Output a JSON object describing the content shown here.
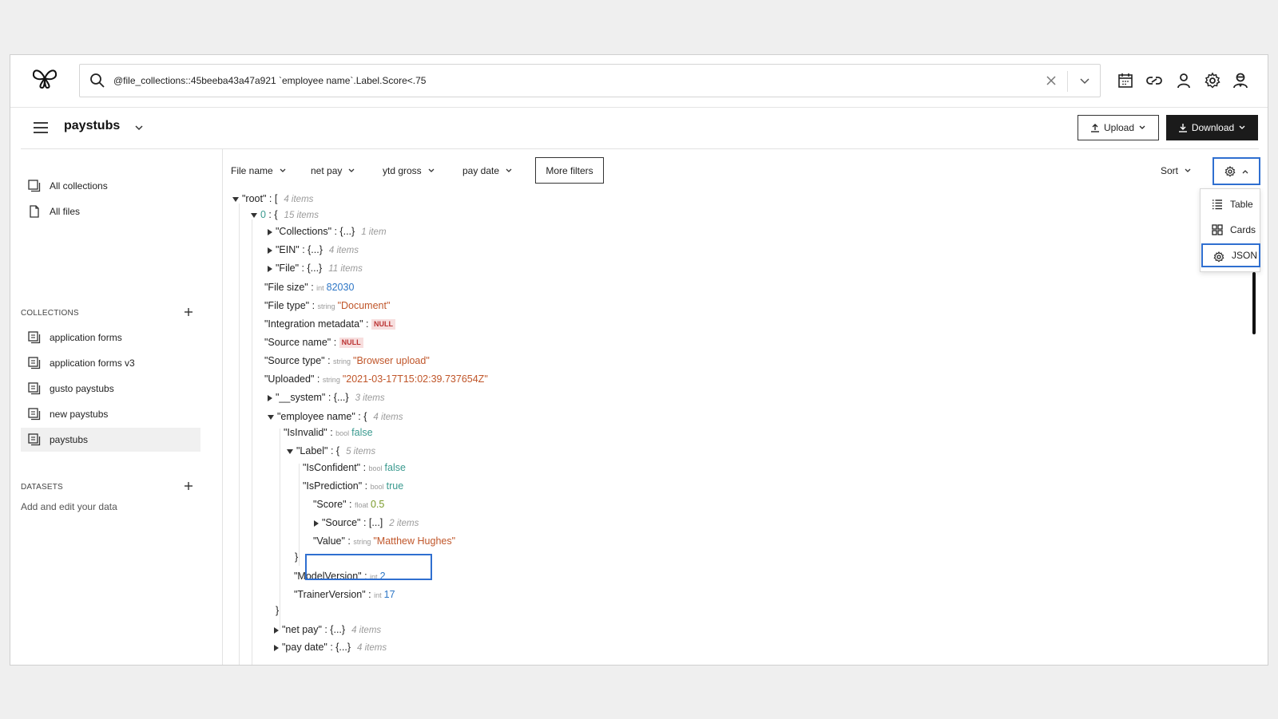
{
  "search": {
    "query": "@file_collections::45beeba43a47a921   `employee name`.Label.Score<.75"
  },
  "header": {
    "collection_title": "paystubs",
    "upload_label": "Upload",
    "download_label": "Download"
  },
  "sidebar": {
    "nav": [
      {
        "label": "All collections"
      },
      {
        "label": "All files"
      }
    ],
    "collections_heading": "COLLECTIONS",
    "collections": [
      {
        "label": "application forms"
      },
      {
        "label": "application forms v3"
      },
      {
        "label": "gusto paystubs"
      },
      {
        "label": "new paystubs"
      },
      {
        "label": "paystubs"
      }
    ],
    "datasets_heading": "DATASETS",
    "datasets_hint": "Add and edit your data"
  },
  "filters": [
    {
      "label": "File name"
    },
    {
      "label": "net pay"
    },
    {
      "label": "ytd gross"
    },
    {
      "label": "pay date"
    }
  ],
  "more_filters_label": "More filters",
  "sort_label": "Sort",
  "view_menu": [
    {
      "label": "Table"
    },
    {
      "label": "Cards"
    },
    {
      "label": "JSON"
    }
  ],
  "tree": {
    "root_key": "\"root\"",
    "root_count": "4 items",
    "item0_key": "0",
    "item0_count": "15 items",
    "collections_key": "\"Collections\"",
    "collections_count": "1 item",
    "ein_key": "\"EIN\"",
    "ein_count": "4 items",
    "file_key": "\"File\"",
    "file_count": "11 items",
    "filesize_key": "\"File size\"",
    "filesize_type": "int",
    "filesize_val": "82030",
    "filetype_key": "\"File type\"",
    "filetype_type": "string",
    "filetype_val": "\"Document\"",
    "intmeta_key": "\"Integration metadata\"",
    "null_label": "NULL",
    "sourcename_key": "\"Source name\"",
    "sourcetype_key": "\"Source type\"",
    "sourcetype_type": "string",
    "sourcetype_val": "\"Browser upload\"",
    "uploaded_key": "\"Uploaded\"",
    "uploaded_type": "string",
    "uploaded_val": "\"2021-03-17T15:02:39.737654Z\"",
    "system_key": "\"__system\"",
    "system_count": "3 items",
    "empname_key": "\"employee name\"",
    "empname_count": "4 items",
    "isinvalid_key": "\"IsInvalid\"",
    "bool_type": "bool",
    "false_val": "false",
    "true_val": "true",
    "label_key": "\"Label\"",
    "label_count": "5 items",
    "isconfident_key": "\"IsConfident\"",
    "isprediction_key": "\"IsPrediction\"",
    "score_key": "\"Score\"",
    "score_type": "float",
    "score_val": "0.5",
    "source_key": "\"Source\"",
    "source_count": "2 items",
    "value_key": "\"Value\"",
    "value_type": "string",
    "value_val": "\"Matthew Hughes\"",
    "modelversion_key": "\"ModelVersion\"",
    "int_type": "int",
    "modelversion_val": "2",
    "trainerversion_key": "\"TrainerVersion\"",
    "trainerversion_val": "17",
    "netpay_key": "\"net pay\"",
    "netpay_count": "4 items",
    "paydate_key": "\"pay date\"",
    "paydate_count": "4 items"
  },
  "colors": {
    "accent_blue": "#2f6fd0",
    "string": "#c0562a",
    "number": "#2d76c6",
    "bool": "#3a9a8f",
    "null_bg": "#f7dede"
  }
}
